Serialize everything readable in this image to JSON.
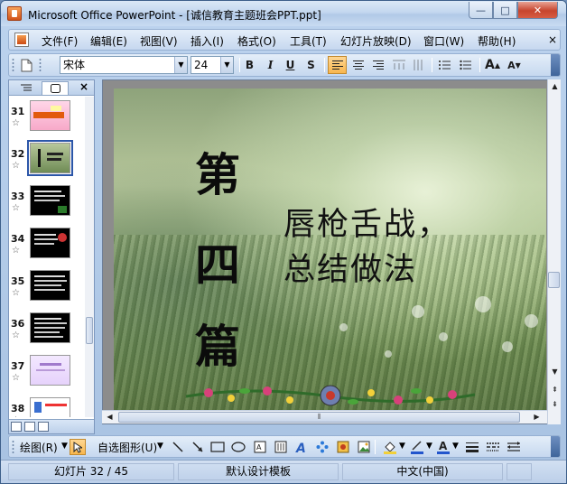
{
  "window": {
    "title": "Microsoft Office PowerPoint - [诚信教育主题班会PPT.ppt]",
    "minimize_label": "—",
    "maximize_label": "□",
    "close_label": "✕"
  },
  "menubar": {
    "items": [
      "文件(F)",
      "编辑(E)",
      "视图(V)",
      "插入(I)",
      "格式(O)",
      "工具(T)",
      "幻灯片放映(D)",
      "窗口(W)",
      "帮助(H)"
    ],
    "close_doc_label": "×"
  },
  "format_toolbar": {
    "font_name": "宋体",
    "font_size": "24",
    "bold": "B",
    "italic": "I",
    "underline": "U",
    "shadow": "S",
    "grow_font": "A",
    "shrink_font": "A"
  },
  "slides_pane": {
    "outline_tab_icon": "outline-icon",
    "slides_tab_icon": "slides-icon",
    "close_label": "×",
    "thumbnails": [
      {
        "number": "31",
        "star": "☆",
        "selected": false
      },
      {
        "number": "32",
        "star": "☆",
        "selected": true
      },
      {
        "number": "33",
        "star": "☆",
        "selected": false
      },
      {
        "number": "34",
        "star": "☆",
        "selected": false
      },
      {
        "number": "35",
        "star": "☆",
        "selected": false
      },
      {
        "number": "36",
        "star": "☆",
        "selected": false
      },
      {
        "number": "37",
        "star": "☆",
        "selected": false
      },
      {
        "number": "38",
        "star": "☆",
        "selected": false
      }
    ]
  },
  "slide": {
    "vertical_chars": [
      "第",
      "四",
      "篇"
    ],
    "line1": "唇枪舌战，",
    "line2": "总结做法"
  },
  "draw_toolbar": {
    "draw_label": "绘图(R)",
    "autoshapes_label": "自选图形(U)"
  },
  "statusbar": {
    "slide_position": "幻灯片 32 / 45",
    "design_template": "默认设计模板",
    "language": "中文(中国)"
  },
  "colors": {
    "selected_thumb_border": "#2c56a8",
    "active_button": "#f8b64e",
    "close_button": "#c7442e"
  }
}
